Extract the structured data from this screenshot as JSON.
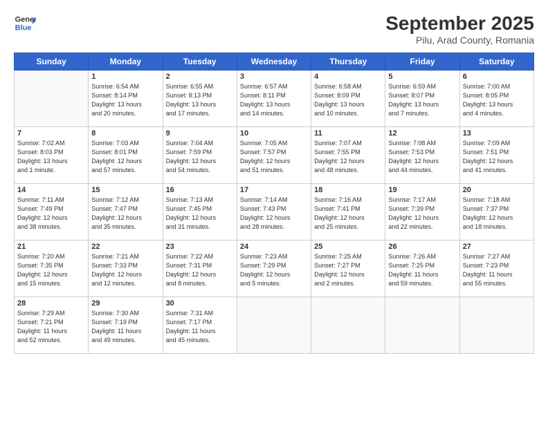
{
  "header": {
    "title": "September 2025",
    "subtitle": "Pilu, Arad County, Romania",
    "logo_general": "General",
    "logo_blue": "Blue"
  },
  "weekdays": [
    "Sunday",
    "Monday",
    "Tuesday",
    "Wednesday",
    "Thursday",
    "Friday",
    "Saturday"
  ],
  "weeks": [
    [
      {
        "day": "",
        "info": ""
      },
      {
        "day": "1",
        "info": "Sunrise: 6:54 AM\nSunset: 8:14 PM\nDaylight: 13 hours\nand 20 minutes."
      },
      {
        "day": "2",
        "info": "Sunrise: 6:55 AM\nSunset: 8:13 PM\nDaylight: 13 hours\nand 17 minutes."
      },
      {
        "day": "3",
        "info": "Sunrise: 6:57 AM\nSunset: 8:11 PM\nDaylight: 13 hours\nand 14 minutes."
      },
      {
        "day": "4",
        "info": "Sunrise: 6:58 AM\nSunset: 8:09 PM\nDaylight: 13 hours\nand 10 minutes."
      },
      {
        "day": "5",
        "info": "Sunrise: 6:59 AM\nSunset: 8:07 PM\nDaylight: 13 hours\nand 7 minutes."
      },
      {
        "day": "6",
        "info": "Sunrise: 7:00 AM\nSunset: 8:05 PM\nDaylight: 13 hours\nand 4 minutes."
      }
    ],
    [
      {
        "day": "7",
        "info": "Sunrise: 7:02 AM\nSunset: 8:03 PM\nDaylight: 13 hours\nand 1 minute."
      },
      {
        "day": "8",
        "info": "Sunrise: 7:03 AM\nSunset: 8:01 PM\nDaylight: 12 hours\nand 57 minutes."
      },
      {
        "day": "9",
        "info": "Sunrise: 7:04 AM\nSunset: 7:59 PM\nDaylight: 12 hours\nand 54 minutes."
      },
      {
        "day": "10",
        "info": "Sunrise: 7:05 AM\nSunset: 7:57 PM\nDaylight: 12 hours\nand 51 minutes."
      },
      {
        "day": "11",
        "info": "Sunrise: 7:07 AM\nSunset: 7:55 PM\nDaylight: 12 hours\nand 48 minutes."
      },
      {
        "day": "12",
        "info": "Sunrise: 7:08 AM\nSunset: 7:53 PM\nDaylight: 12 hours\nand 44 minutes."
      },
      {
        "day": "13",
        "info": "Sunrise: 7:09 AM\nSunset: 7:51 PM\nDaylight: 12 hours\nand 41 minutes."
      }
    ],
    [
      {
        "day": "14",
        "info": "Sunrise: 7:11 AM\nSunset: 7:49 PM\nDaylight: 12 hours\nand 38 minutes."
      },
      {
        "day": "15",
        "info": "Sunrise: 7:12 AM\nSunset: 7:47 PM\nDaylight: 12 hours\nand 35 minutes."
      },
      {
        "day": "16",
        "info": "Sunrise: 7:13 AM\nSunset: 7:45 PM\nDaylight: 12 hours\nand 31 minutes."
      },
      {
        "day": "17",
        "info": "Sunrise: 7:14 AM\nSunset: 7:43 PM\nDaylight: 12 hours\nand 28 minutes."
      },
      {
        "day": "18",
        "info": "Sunrise: 7:16 AM\nSunset: 7:41 PM\nDaylight: 12 hours\nand 25 minutes."
      },
      {
        "day": "19",
        "info": "Sunrise: 7:17 AM\nSunset: 7:39 PM\nDaylight: 12 hours\nand 22 minutes."
      },
      {
        "day": "20",
        "info": "Sunrise: 7:18 AM\nSunset: 7:37 PM\nDaylight: 12 hours\nand 18 minutes."
      }
    ],
    [
      {
        "day": "21",
        "info": "Sunrise: 7:20 AM\nSunset: 7:35 PM\nDaylight: 12 hours\nand 15 minutes."
      },
      {
        "day": "22",
        "info": "Sunrise: 7:21 AM\nSunset: 7:33 PM\nDaylight: 12 hours\nand 12 minutes."
      },
      {
        "day": "23",
        "info": "Sunrise: 7:22 AM\nSunset: 7:31 PM\nDaylight: 12 hours\nand 8 minutes."
      },
      {
        "day": "24",
        "info": "Sunrise: 7:23 AM\nSunset: 7:29 PM\nDaylight: 12 hours\nand 5 minutes."
      },
      {
        "day": "25",
        "info": "Sunrise: 7:25 AM\nSunset: 7:27 PM\nDaylight: 12 hours\nand 2 minutes."
      },
      {
        "day": "26",
        "info": "Sunrise: 7:26 AM\nSunset: 7:25 PM\nDaylight: 11 hours\nand 59 minutes."
      },
      {
        "day": "27",
        "info": "Sunrise: 7:27 AM\nSunset: 7:23 PM\nDaylight: 11 hours\nand 55 minutes."
      }
    ],
    [
      {
        "day": "28",
        "info": "Sunrise: 7:29 AM\nSunset: 7:21 PM\nDaylight: 11 hours\nand 52 minutes."
      },
      {
        "day": "29",
        "info": "Sunrise: 7:30 AM\nSunset: 7:19 PM\nDaylight: 11 hours\nand 49 minutes."
      },
      {
        "day": "30",
        "info": "Sunrise: 7:31 AM\nSunset: 7:17 PM\nDaylight: 11 hours\nand 45 minutes."
      },
      {
        "day": "",
        "info": ""
      },
      {
        "day": "",
        "info": ""
      },
      {
        "day": "",
        "info": ""
      },
      {
        "day": "",
        "info": ""
      }
    ]
  ]
}
